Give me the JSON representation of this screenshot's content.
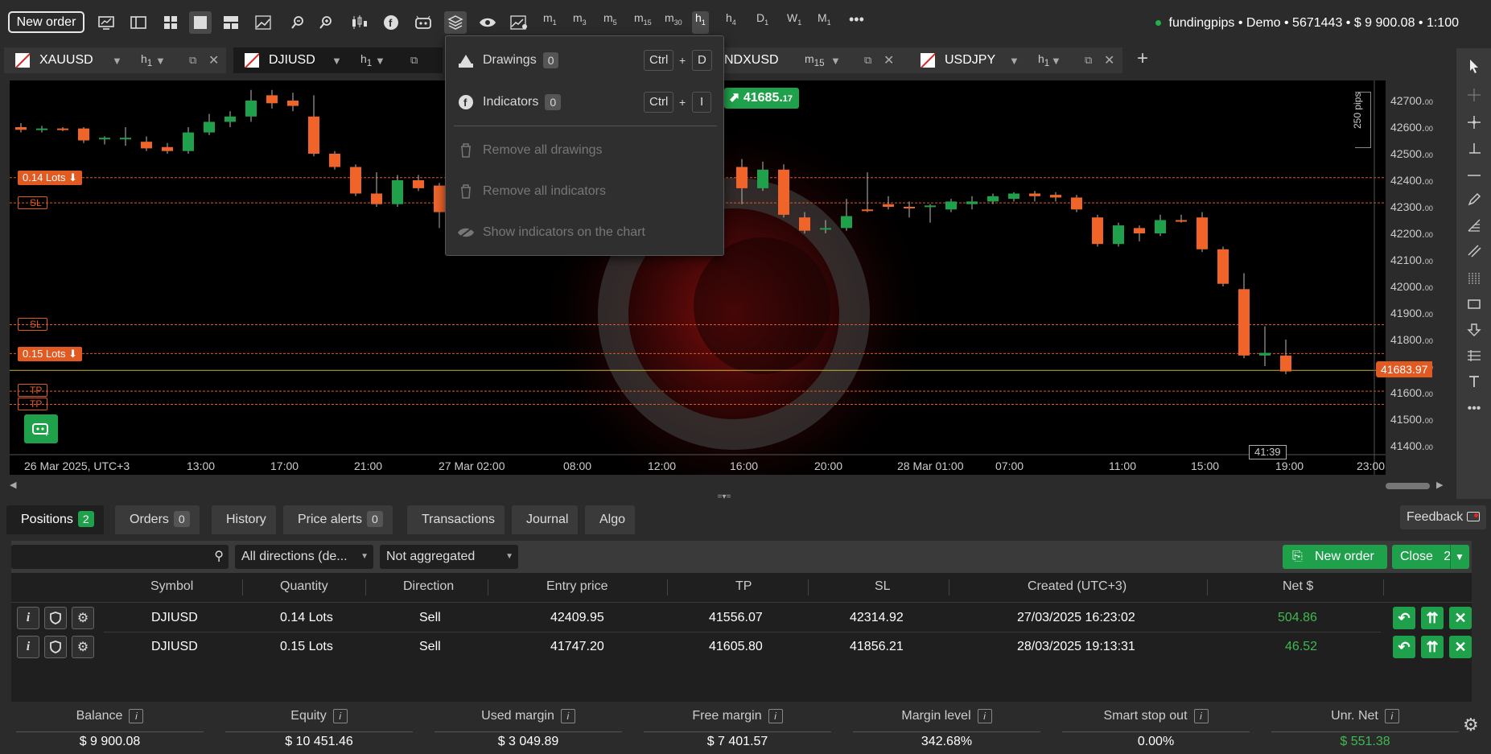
{
  "toolbar": {
    "new_order": "New order",
    "timeframes": [
      {
        "main": "m",
        "sub": "1"
      },
      {
        "main": "m",
        "sub": "3"
      },
      {
        "main": "m",
        "sub": "5"
      },
      {
        "main": "m",
        "sub": "15"
      },
      {
        "main": "m",
        "sub": "30"
      },
      {
        "main": "h",
        "sub": "1"
      },
      {
        "main": "h",
        "sub": "4"
      },
      {
        "main": "D",
        "sub": "1"
      },
      {
        "main": "W",
        "sub": "1"
      },
      {
        "main": "M",
        "sub": "1"
      }
    ],
    "more": "•••",
    "account": "fundingpips • Demo • 5671443 • $ 9 900.08 • 1:100"
  },
  "tabs": [
    {
      "symbol": "XAUUSD",
      "tf_main": "h",
      "tf_sub": "1"
    },
    {
      "symbol": "DJIUSD",
      "tf_main": "h",
      "tf_sub": "1"
    },
    {
      "symbol": "NDXUSD",
      "tf_main": "m",
      "tf_sub": "15"
    },
    {
      "symbol": "USDJPY",
      "tf_main": "h",
      "tf_sub": "1"
    }
  ],
  "add_tab": "+",
  "dropdown": {
    "drawings": {
      "label": "Drawings",
      "count": "0",
      "k1": "Ctrl",
      "plus": "+",
      "k2": "D"
    },
    "indicators": {
      "label": "Indicators",
      "count": "0",
      "k1": "Ctrl",
      "plus": "+",
      "k2": "I"
    },
    "remove_drawings": "Remove all drawings",
    "remove_indicators": "Remove all indicators",
    "show_indicators": "Show indicators on the chart"
  },
  "chart": {
    "buy_price": "41685.17",
    "buy_price_main": "41685.",
    "buy_price_frac": "17",
    "current_price": "41683.97",
    "timer": "41:39",
    "pips_label": "250 pips",
    "lot1": "0.14 Lots",
    "lot2": "0.15 Lots",
    "sl": "SL",
    "tp": "TP",
    "y_labels": [
      {
        "main": "42700.",
        "sub": "00"
      },
      {
        "main": "42600.",
        "sub": "00"
      },
      {
        "main": "42500.",
        "sub": "00"
      },
      {
        "main": "42400.",
        "sub": "00"
      },
      {
        "main": "42300.",
        "sub": "00"
      },
      {
        "main": "42200.",
        "sub": "00"
      },
      {
        "main": "42100.",
        "sub": "00"
      },
      {
        "main": "42000.",
        "sub": "00"
      },
      {
        "main": "41900.",
        "sub": "00"
      },
      {
        "main": "41800.",
        "sub": "00"
      },
      {
        "main": "41700.",
        "sub": "00"
      },
      {
        "main": "41600.",
        "sub": "00"
      },
      {
        "main": "41500.",
        "sub": "00"
      },
      {
        "main": "41400.",
        "sub": "00"
      }
    ],
    "x_labels": [
      "26 Mar 2025, UTC+3",
      "13:00",
      "17:00",
      "21:00",
      "27 Mar 02:00",
      "08:00",
      "12:00",
      "16:00",
      "20:00",
      "28 Mar 01:00",
      "07:00",
      "11:00",
      "15:00",
      "19:00",
      "23:00"
    ]
  },
  "bottom": {
    "tabs": [
      {
        "label": "Positions",
        "badge": "2"
      },
      {
        "label": "Orders",
        "badge": "0"
      },
      {
        "label": "History"
      },
      {
        "label": "Price alerts",
        "badge": "0"
      },
      {
        "label": "Transactions"
      },
      {
        "label": "Journal"
      },
      {
        "label": "Algo"
      }
    ],
    "feedback": "Feedback",
    "direction_select": "All directions (de...",
    "aggregation_select": "Not aggregated",
    "new_order": "New order",
    "close": "Close",
    "close_count": "2",
    "columns": [
      "Symbol",
      "Quantity",
      "Direction",
      "Entry price",
      "TP",
      "SL",
      "Created (UTC+3)",
      "Net $"
    ],
    "rows": [
      {
        "symbol": "DJIUSD",
        "quantity": "0.14 Lots",
        "direction": "Sell",
        "entry": "42409.95",
        "tp": "41556.07",
        "sl": "42314.92",
        "created": "27/03/2025 16:23:02",
        "net": "504.86"
      },
      {
        "symbol": "DJIUSD",
        "quantity": "0.15 Lots",
        "direction": "Sell",
        "entry": "41747.20",
        "tp": "41605.80",
        "sl": "41856.21",
        "created": "28/03/2025 19:13:31",
        "net": "46.52"
      }
    ],
    "summary": [
      {
        "label": "Balance",
        "value": "$ 9 900.08"
      },
      {
        "label": "Equity",
        "value": "$ 10 451.46"
      },
      {
        "label": "Used margin",
        "value": "$ 3 049.89"
      },
      {
        "label": "Free margin",
        "value": "$ 7 401.57"
      },
      {
        "label": "Margin level",
        "value": "342.68%"
      },
      {
        "label": "Smart stop out",
        "value": "0.00%"
      },
      {
        "label": "Unr. Net",
        "value": "$ 551.38"
      }
    ]
  },
  "colors": {
    "green": "#1fa04a",
    "orange": "#e05a22",
    "profit": "#3fb950"
  }
}
